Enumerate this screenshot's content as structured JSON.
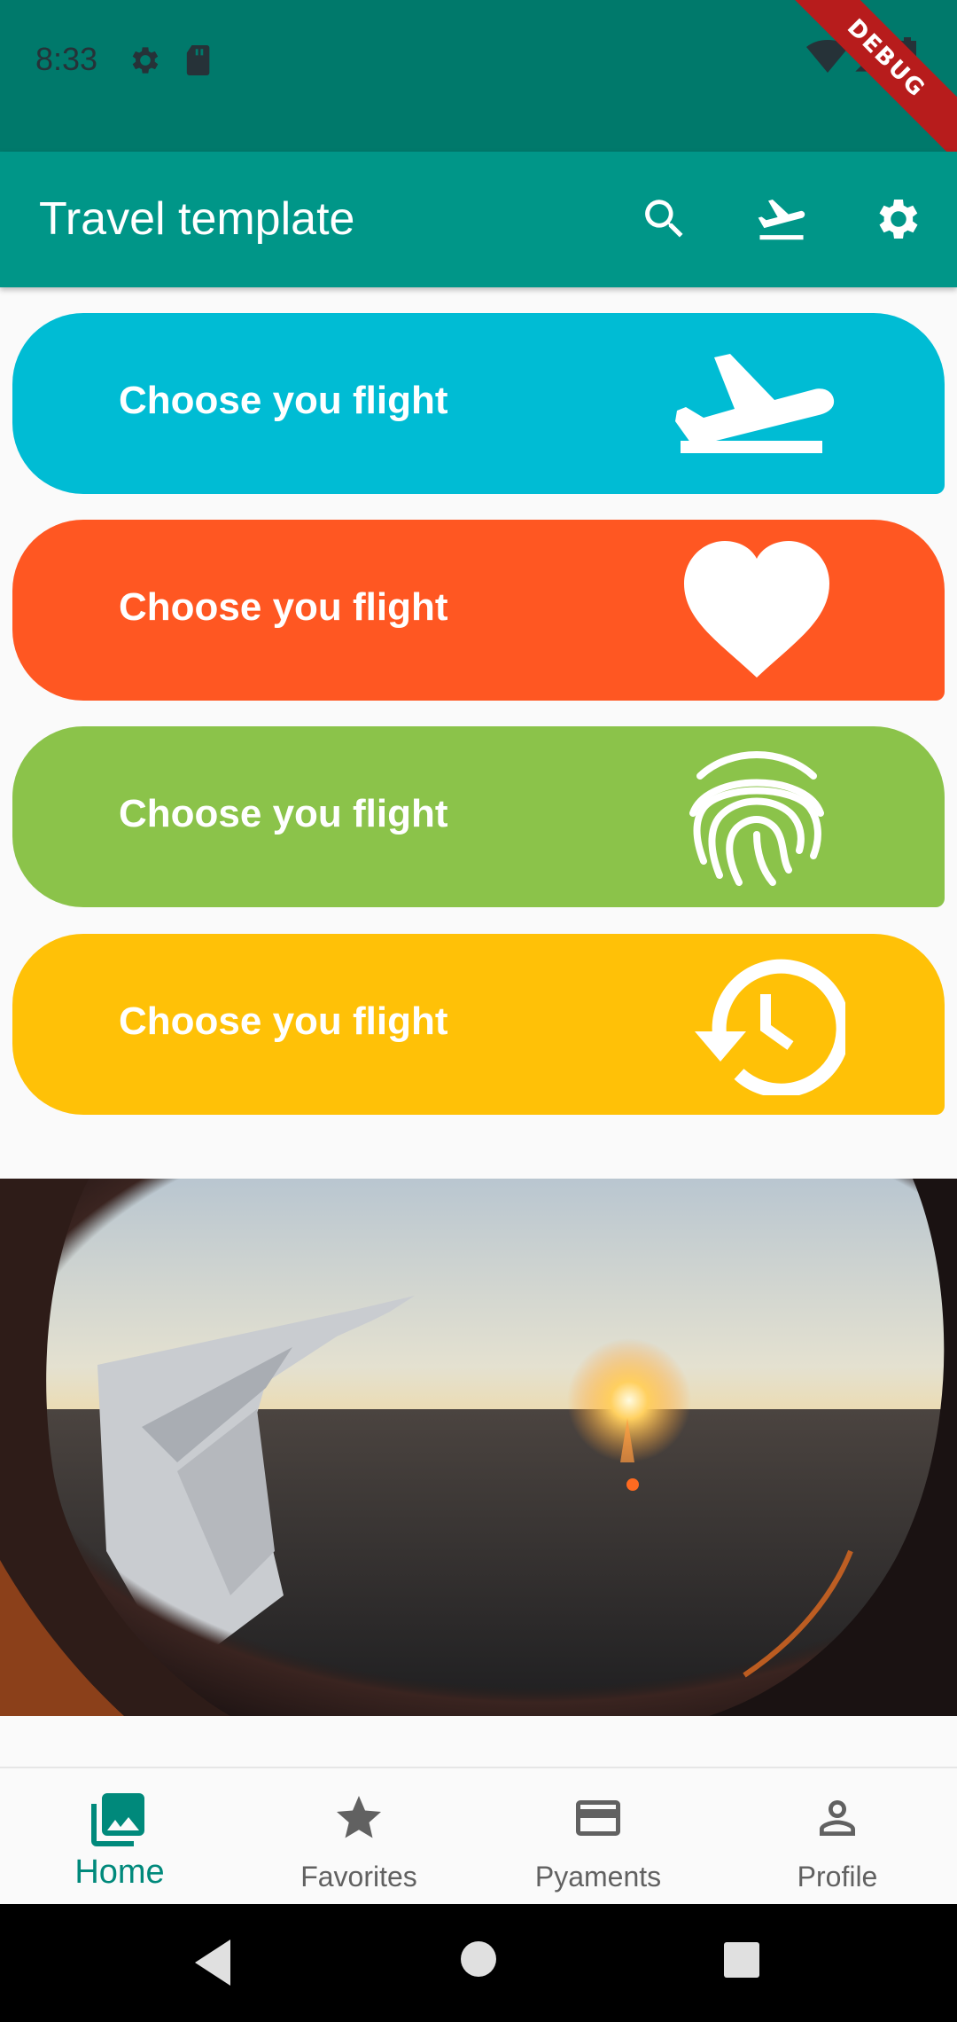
{
  "status_bar": {
    "time": "8:33",
    "icons": [
      "gear-icon",
      "sd-card-icon",
      "wifi-icon",
      "signal-icon",
      "battery-icon"
    ],
    "debug_label": "DEBUG"
  },
  "app_bar": {
    "title": "Travel template",
    "actions": [
      "search-icon",
      "flight-takeoff-icon",
      "settings-icon"
    ]
  },
  "cards": [
    {
      "label": "Choose you flight",
      "icon": "flight-takeoff-icon",
      "color": "#00bcd4"
    },
    {
      "label": "Choose you flight",
      "icon": "heart-icon",
      "color": "#ff5722"
    },
    {
      "label": "Choose you flight",
      "icon": "fingerprint-icon",
      "color": "#8bc34a"
    },
    {
      "label": "Choose you flight",
      "icon": "history-icon",
      "color": "#ffc107"
    }
  ],
  "photo": {
    "subject": "airplane-window-sunset-image"
  },
  "bottom_nav": {
    "items": [
      {
        "label": "Home",
        "icon": "photo-library-icon",
        "active": true
      },
      {
        "label": "Favorites",
        "icon": "star-icon",
        "active": false
      },
      {
        "label": "Pyaments",
        "icon": "credit-card-icon",
        "active": false
      },
      {
        "label": "Profile",
        "icon": "person-icon",
        "active": false
      }
    ],
    "active_color": "#00897b",
    "inactive_color": "#616161"
  },
  "system_nav": [
    "back-icon",
    "home-circle-icon",
    "recents-icon"
  ]
}
